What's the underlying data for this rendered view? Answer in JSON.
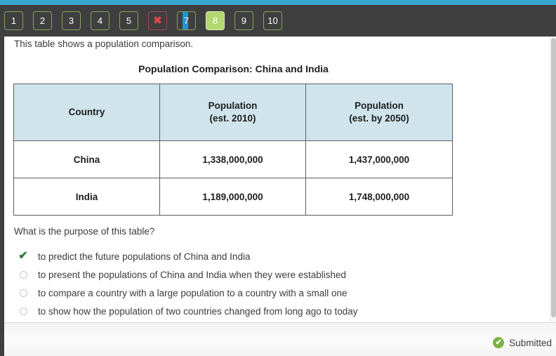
{
  "theme": {
    "accent_bar_color": "#3aa7cf",
    "header_bg_color": "#3f3f3f",
    "current_item_color": "#b3d870",
    "marked_item_color": "#1d97cc",
    "wrong_item_color": "#e04545",
    "table_header_bg_color": "#cfe4eb",
    "table_border_color": "#5a5f63",
    "correct_check_color": "#2f7d32",
    "submitted_badge_color": "#7cb342"
  },
  "nav": {
    "items": [
      {
        "label": "1",
        "state": "normal"
      },
      {
        "label": "2",
        "state": "normal"
      },
      {
        "label": "3",
        "state": "normal"
      },
      {
        "label": "4",
        "state": "normal"
      },
      {
        "label": "5",
        "state": "normal"
      },
      {
        "label": "✖",
        "state": "wrong"
      },
      {
        "label": "7",
        "state": "marked"
      },
      {
        "label": "8",
        "state": "current"
      },
      {
        "label": "9",
        "state": "normal"
      },
      {
        "label": "10",
        "state": "normal"
      }
    ]
  },
  "content": {
    "intro_text": "This table shows a population comparison.",
    "table_title": "Population Comparison: China and India",
    "table": {
      "headers": [
        {
          "line1": "Country",
          "line2": ""
        },
        {
          "line1": "Population",
          "line2": "(est. 2010)"
        },
        {
          "line1": "Population",
          "line2": "(est. by 2050)"
        }
      ],
      "rows": [
        [
          "China",
          "1,338,000,000",
          "1,437,000,000"
        ],
        [
          "India",
          "1,189,000,000",
          "1,748,000,000"
        ]
      ]
    },
    "question": "What is the purpose of this table?",
    "options": [
      {
        "label": "to predict the future populations of China and India",
        "marker": "check"
      },
      {
        "label": "to present the populations of China and India when they were established",
        "marker": "radio"
      },
      {
        "label": "to compare a country with a large population to a country with a small one",
        "marker": "radio"
      },
      {
        "label": "to show how the population of two countries changed from long ago to today",
        "marker": "radio"
      }
    ]
  },
  "footer": {
    "status_text": "Submitted",
    "status_glyph": "✔"
  }
}
